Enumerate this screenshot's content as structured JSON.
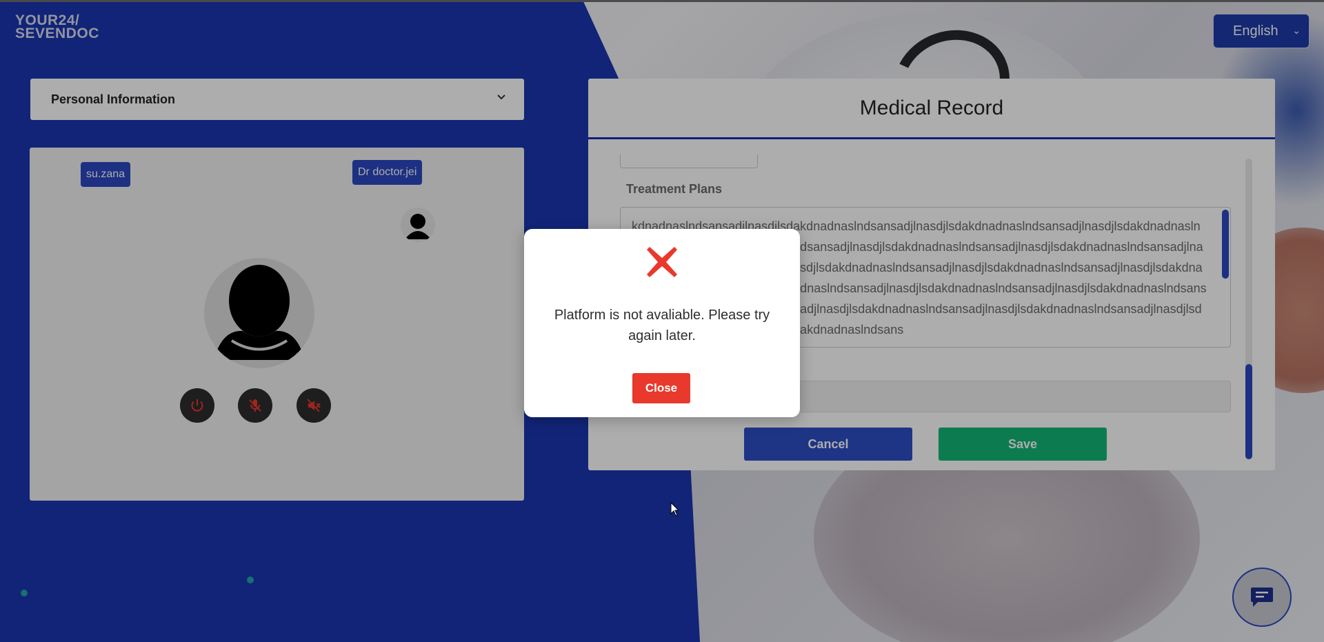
{
  "brand": {
    "line1": "YOUR24/",
    "line2": "SEVENDOC"
  },
  "language": {
    "selected": "English"
  },
  "accordion": {
    "title": "Personal Information"
  },
  "video": {
    "patient_tag": "su.zana",
    "doctor_tag": "Dr doctor.jei",
    "controls": [
      "power-icon",
      "mic-off-icon",
      "speaker-off-icon"
    ],
    "control_color": "#e8392c"
  },
  "medical_record": {
    "title": "Medical Record",
    "treatment_label": "Treatment Plans",
    "treatment_text": "kdnadnaslndsansadjlnasdjlsdakdnadnaslndsansadjlnasdjlsdakdnadnaslndsansadjlnasdjlsdakdnadnaslndsansadjlnasdjlsdakdnadnaslndsansadjlnasdjlsdakdnadnaslndsansadjlnasdjlsdakdnadnaslndsansadjlnasdjlsdakdnadnaslndsansadjlnasdjlsdakdnadnaslndsansadjlnasdjlsdakdnadnaslndsansadjlnasdjlsdakdnadnaslndsansadjlnasdjlsdakdnadnaslndsansadjlnasdjlsdakdnadnaslndsansadjlnasdjlsdakdnadnaslndsansadjlnasdjlsdakdnadnaslndsansadjlnasdjlsdakdnadnaslndsansadjlnasdjlsdakdnadnaslndsansadjlnasdjlsdakdnadnaslndsansadjlnasdjlsdakdnadnaslndsans",
    "cancel_label": "Cancel",
    "save_label": "Save"
  },
  "modal": {
    "icon": "error-x-icon",
    "message": "Platform is not avaliable. Please try again later.",
    "close_label": "Close"
  },
  "chat": {
    "icon": "chat-icon"
  },
  "colors": {
    "brand_blue": "#1a35b0",
    "save_green": "#12b776",
    "error_red": "#e8392c"
  }
}
